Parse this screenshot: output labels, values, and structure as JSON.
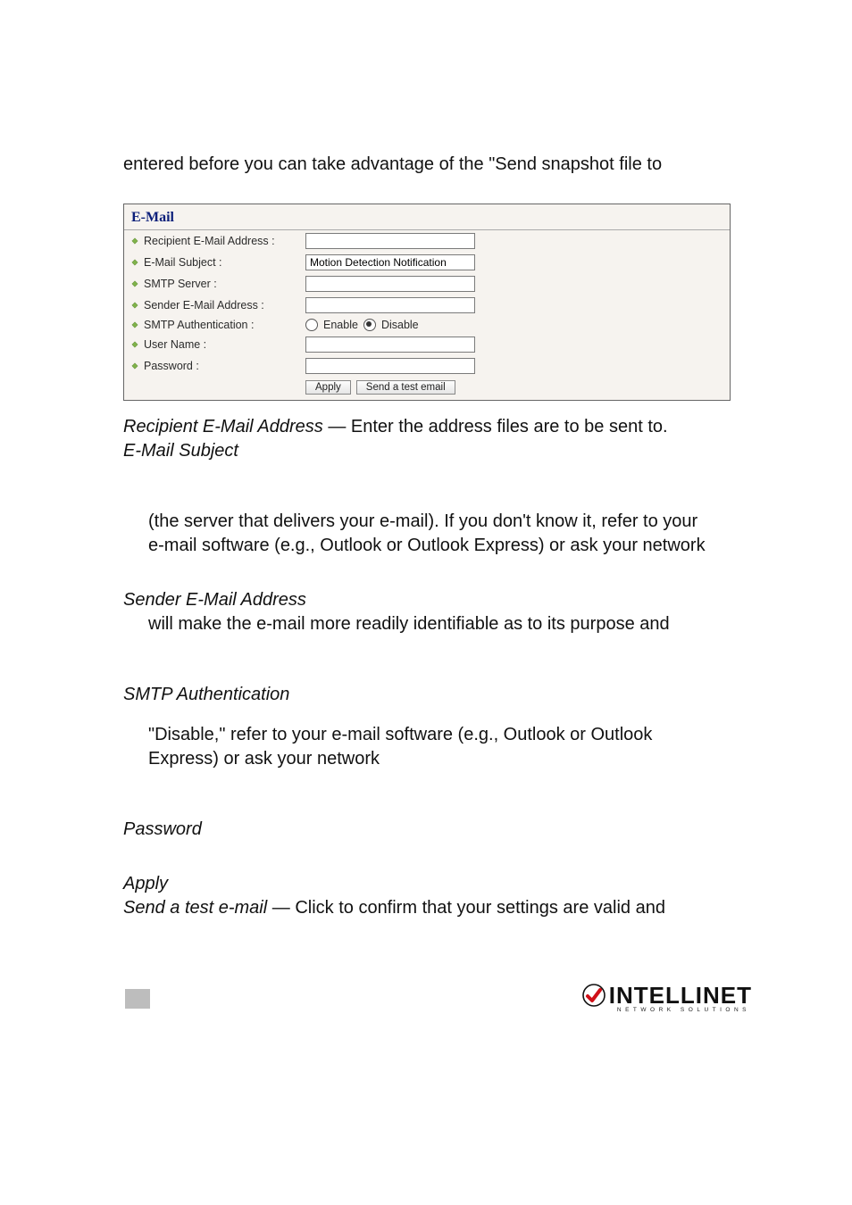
{
  "intro": "entered before you can take advantage of the \"Send snapshot file to",
  "panel": {
    "title": "E-Mail",
    "fields": {
      "recipient": {
        "label": "Recipient E-Mail Address :",
        "value": ""
      },
      "subject": {
        "label": "E-Mail Subject :",
        "value": "Motion Detection Notification"
      },
      "smtp": {
        "label": "SMTP Server :",
        "value": ""
      },
      "sender": {
        "label": "Sender E-Mail Address :",
        "value": ""
      },
      "auth": {
        "label": "SMTP Authentication :",
        "enable": "Enable",
        "disable": "Disable",
        "selected": "disable"
      },
      "user": {
        "label": "User Name :",
        "value": ""
      },
      "pass": {
        "label": "Password :",
        "value": ""
      }
    },
    "buttons": {
      "apply": "Apply",
      "test": "Send a test email"
    }
  },
  "body": {
    "recip_term": "Recipient E-Mail Address",
    "recip_rest": " — Enter the address files are to be sent to.",
    "subj_term": "E-Mail Subject",
    "smtp_indent1": "(the server that delivers your e-mail). If you don't know it, refer to your",
    "smtp_indent2": "e-mail software (e.g., Outlook or Outlook Express) or ask your network",
    "sender_term": "Sender E-Mail Address",
    "sender_indent": "will make the e-mail more readily identifiable as to its purpose and",
    "auth_term": "SMTP Authentication",
    "auth_indent1": "\"Disable,\" refer to your e-mail software (e.g., Outlook or Outlook",
    "auth_indent2": "Express) or ask your network",
    "pass_term": "Password",
    "apply_term": "Apply",
    "send_term": "Send a test e-mail",
    "send_rest": " — Click to confirm that your settings are valid and"
  },
  "footer": {
    "brand": "INTELLINET",
    "tagline": "NETWORK SOLUTIONS"
  }
}
